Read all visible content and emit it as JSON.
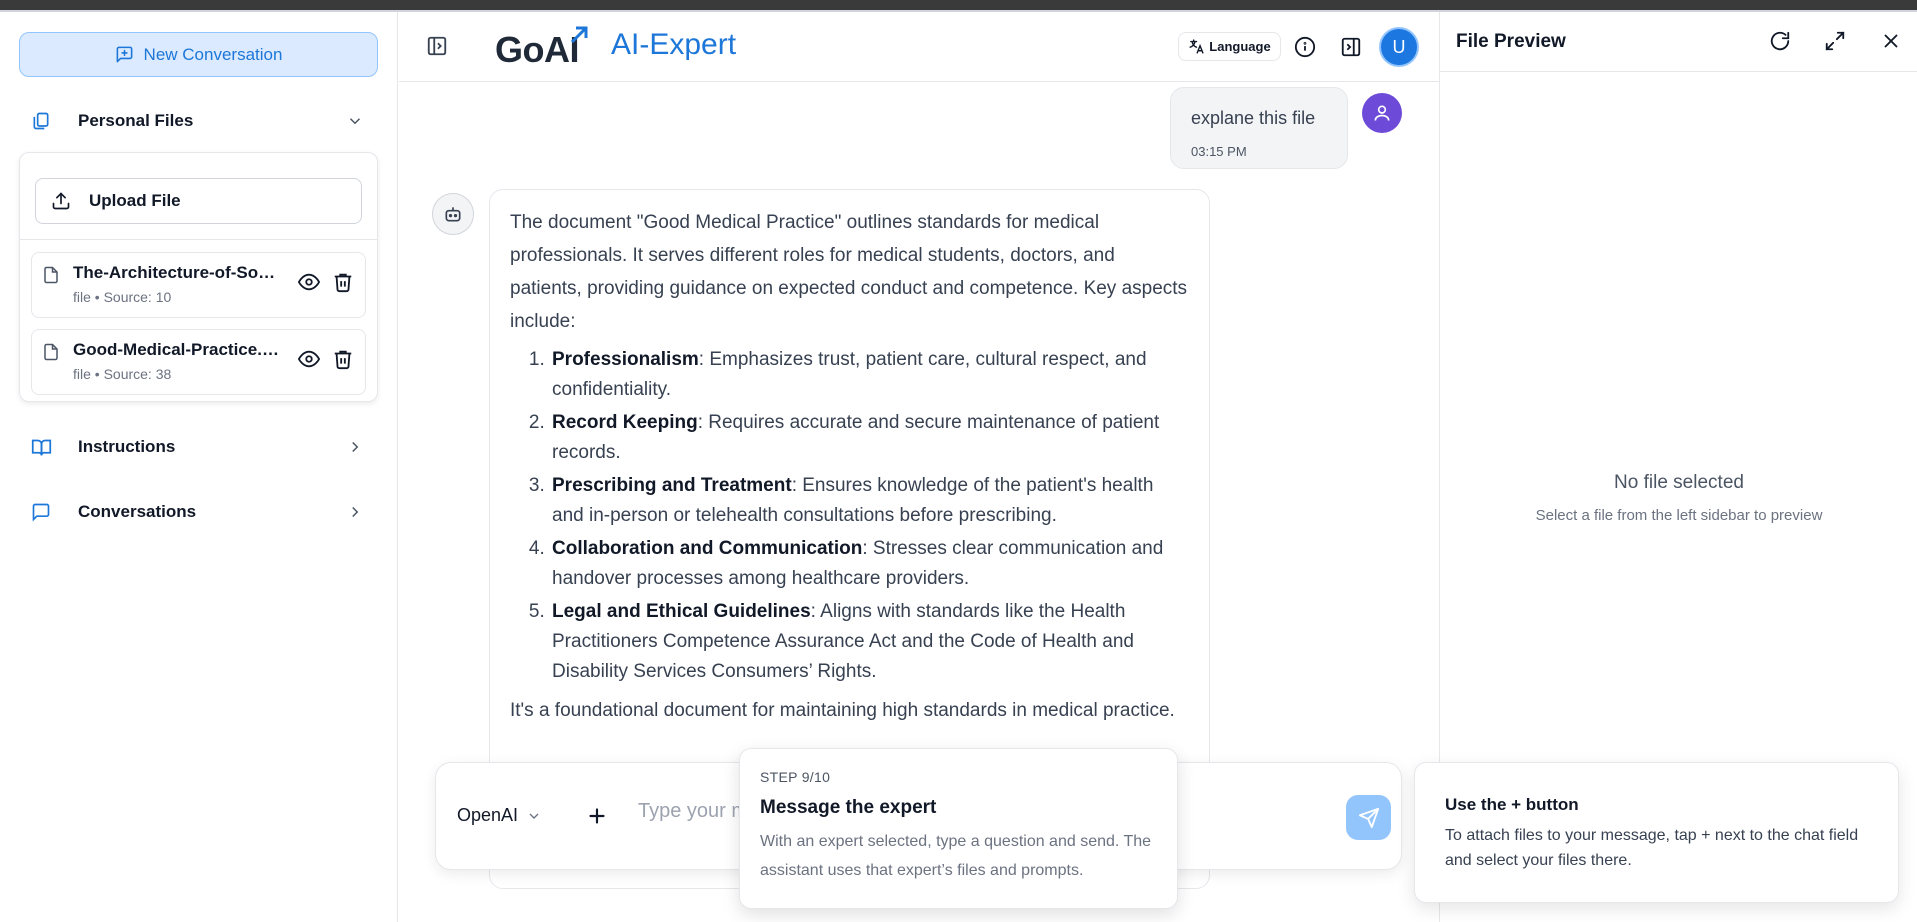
{
  "sidebar": {
    "new_conversation": "New Conversation",
    "personal_files": "Personal Files",
    "upload_file": "Upload File",
    "files": [
      {
        "name": "The-Architecture-of-Sovereignty.pdf",
        "meta": "file • Source: 10"
      },
      {
        "name": "Good-Medical-Practice.pdf",
        "meta": "file • Source: 38"
      }
    ],
    "instructions": "Instructions",
    "conversations": "Conversations"
  },
  "header": {
    "logo": "GoAI",
    "title": "AI-Expert",
    "language": "Language",
    "avatar_initial": "U"
  },
  "chat": {
    "user_message": "explane this file",
    "user_time": "03:15 PM",
    "bot_intro": "The document \"Good Medical Practice\" outlines standards for medical professionals. It serves different roles for medical students, doctors, and patients, providing guidance on expected conduct and competence. Key aspects include:",
    "bot_points": [
      {
        "title": "Professionalism",
        "text": ": Emphasizes trust, patient care, cultural respect, and confidentiality."
      },
      {
        "title": "Record Keeping",
        "text": ": Requires accurate and secure maintenance of patient records."
      },
      {
        "title": "Prescribing and Treatment",
        "text": ": Ensures knowledge of the patient's health and in-person or telehealth consultations before prescribing."
      },
      {
        "title": "Collaboration and Communication",
        "text": ": Stresses clear communication and handover processes among healthcare providers."
      },
      {
        "title": "Legal and Ethical Guidelines",
        "text": ": Aligns with standards like the Health Practitioners Competence Assurance Act and the Code of Health and Disability Services Consumers’ Rights."
      }
    ],
    "bot_outro": "It's a foundational document for maintaining high standards in medical practice."
  },
  "input": {
    "model": "OpenAI",
    "placeholder": "Type your message..."
  },
  "tour": {
    "step": "STEP 9/10",
    "title": "Message the expert",
    "body": "With an expert selected, type a question and send. The assistant uses that expert’s files and prompts."
  },
  "preview": {
    "title": "File Preview",
    "empty_title": "No file selected",
    "empty_hint": "Select a file from the left sidebar to preview"
  },
  "tip": {
    "title": "Use the + button",
    "body": "To attach files to your message, tap + next to the chat field and select your files there."
  },
  "colors": {
    "accent": "#1d77d8",
    "user_avatar": "#6d4bd8",
    "send_button": "#93c5fd"
  }
}
